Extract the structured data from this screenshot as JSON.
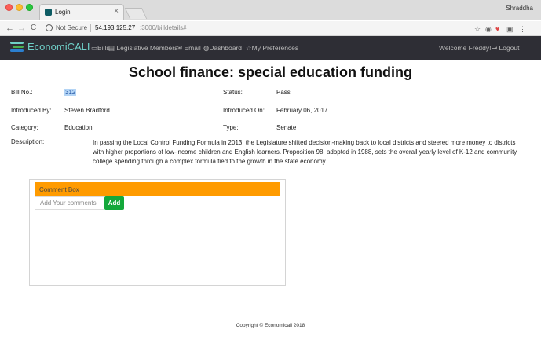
{
  "browser": {
    "tab_title": "Login",
    "tab_close": "×",
    "profile_name": "Shraddha",
    "not_secure": "Not Secure",
    "url_host": "54.193.125.27",
    "url_rest": ":3000/billdetails#"
  },
  "navbar": {
    "brand": "EconomiCALI",
    "items": [
      {
        "icon": "▭",
        "label": "Bills"
      },
      {
        "icon": "▤",
        "label": "Legislative Members"
      },
      {
        "icon": "✉",
        "label": "Email"
      },
      {
        "icon": "◍",
        "label": "Dashboard"
      },
      {
        "icon": "☆",
        "label": "My Preferences"
      }
    ],
    "welcome": "Welcome Freddy!",
    "logout_icon": "⇥",
    "logout": "Logout",
    "brand_colors": [
      "#6fd0c8",
      "#4caf50",
      "#2b7fd0"
    ]
  },
  "bill": {
    "title": "School finance: special education funding",
    "bill_no_label": "Bill No.:",
    "bill_no": "312",
    "status_label": "Status:",
    "status": "Pass",
    "introduced_by_label": "Introduced By:",
    "introduced_by": "Steven Bradford",
    "introduced_on_label": "Introduced On:",
    "introduced_on": "February 06, 2017",
    "category_label": "Category:",
    "category": "Education",
    "type_label": "Type:",
    "type": "Senate",
    "description_label": "Description:",
    "description": "In passing the Local Control Funding Formula in 2013, the Legislature shifted decision-making back to local districts and steered more money to districts with higher proportions of low-income children and English learners. Proposition 98, adopted in 1988, sets the overall yearly level of K-12 and community college spending through a complex formula tied to the growth in the state economy."
  },
  "comments": {
    "title": "Comment Box",
    "placeholder": "Add Your comments",
    "value": "",
    "add_label": "Add",
    "header_color": "#ff9b00",
    "button_color": "#14a83b"
  },
  "footer": {
    "copyright": "Copyright © Economicali 2018"
  }
}
